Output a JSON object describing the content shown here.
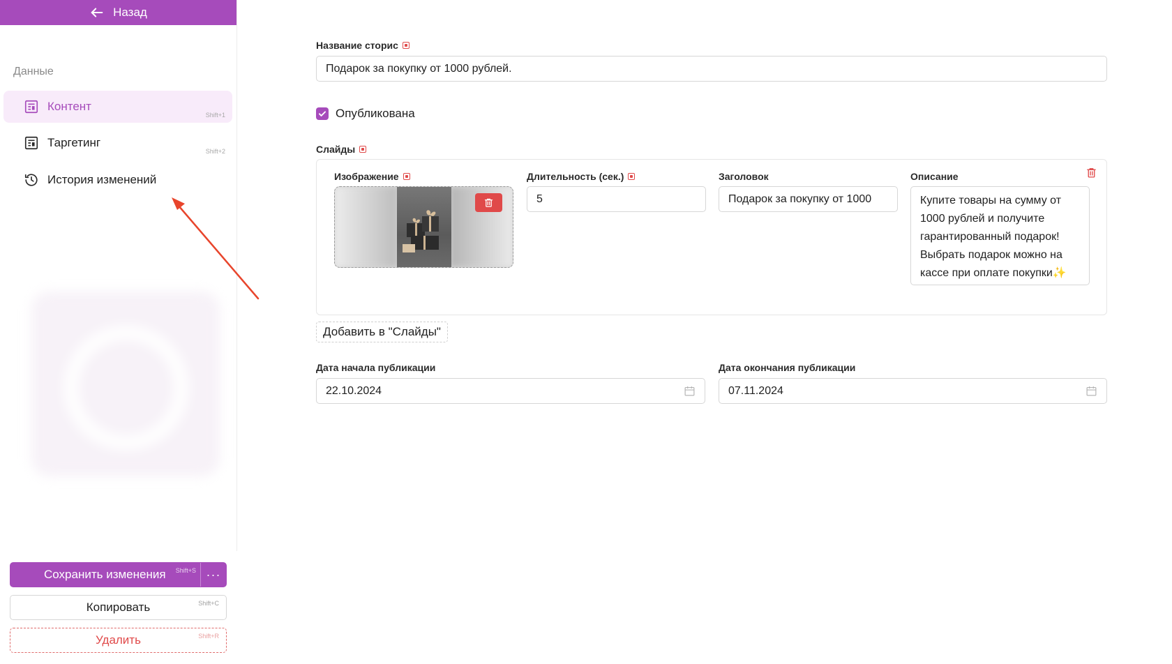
{
  "sidebar": {
    "back_label": "Назад",
    "section_label": "Данные",
    "items": [
      {
        "label": "Контент",
        "hint": "Shift+1",
        "active": true
      },
      {
        "label": "Таргетинг",
        "hint": "Shift+2",
        "active": false
      },
      {
        "label": "История изменений",
        "hint": "",
        "active": false
      }
    ]
  },
  "actions": {
    "save_label": "Сохранить изменения",
    "save_hint": "Shift+S",
    "more_label": "···",
    "copy_label": "Копировать",
    "copy_hint": "Shift+C",
    "delete_label": "Удалить",
    "delete_hint": "Shift+R"
  },
  "form": {
    "story_name_label": "Название сторис",
    "story_name_value": "Подарок за покупку от 1000 рублей.",
    "published_label": "Опубликована",
    "published_checked": true,
    "slides_label": "Слайды",
    "slide": {
      "image_label": "Изображение",
      "duration_label": "Длительность (сек.)",
      "duration_value": "5",
      "title_label": "Заголовок",
      "title_value": "Подарок за покупку от 1000",
      "description_label": "Описание",
      "description_value": "Купите товары на сумму от 1000 рублей и получите гарантированный подарок! Выбрать подарок можно на кассе при оплате покупки✨"
    },
    "add_slide_label": "Добавить в \"Слайды\"",
    "start_date_label": "Дата начала публикации",
    "start_date_value": "22.10.2024",
    "end_date_label": "Дата окончания публикации",
    "end_date_value": "07.11.2024"
  },
  "colors": {
    "accent": "#a64bbb",
    "accent_light": "#f8ebfa",
    "danger": "#e04a4a",
    "annotation_arrow": "#e8452c"
  },
  "icons": {
    "back": "arrow-left-icon",
    "content": "content-list-icon",
    "targeting": "targeting-list-icon",
    "history": "history-icon",
    "delete": "trash-icon",
    "calendar": "calendar-icon",
    "check": "checkmark-icon"
  }
}
